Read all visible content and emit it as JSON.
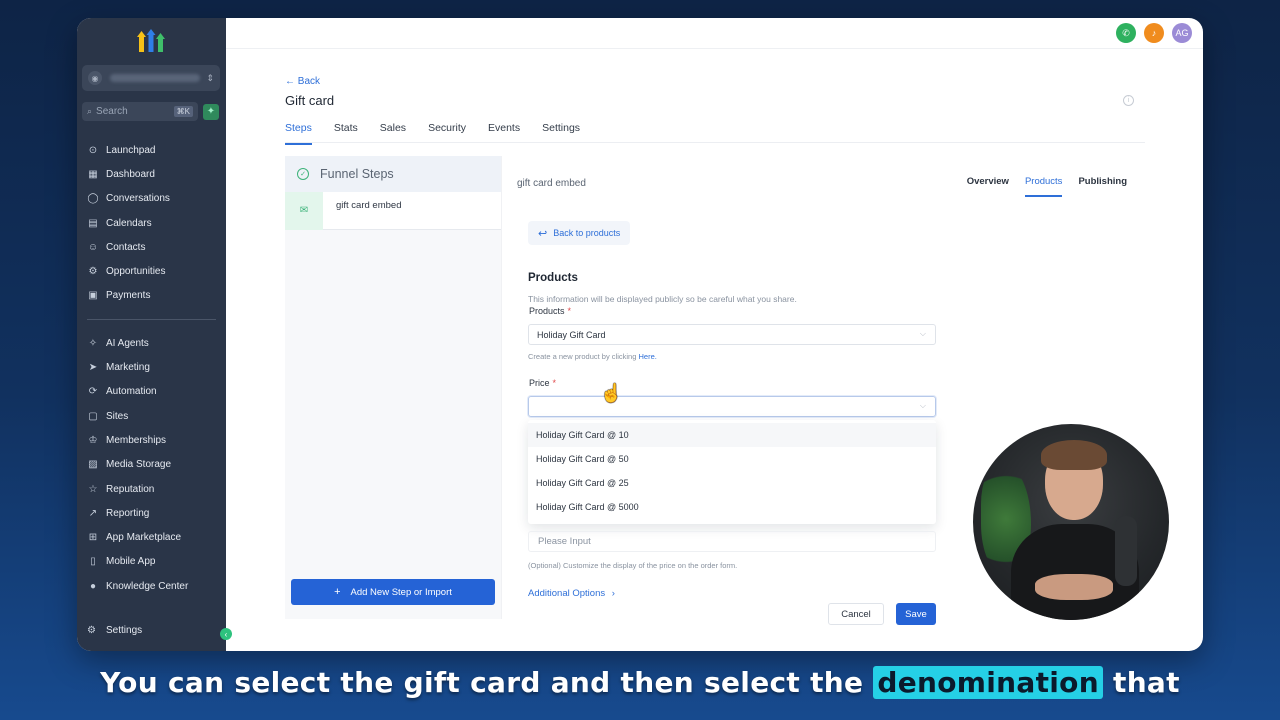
{
  "sidebar": {
    "search_placeholder": "Search",
    "search_shortcut": "⌘K",
    "nav": [
      {
        "label": "Launchpad",
        "icon": "rocket-icon"
      },
      {
        "label": "Dashboard",
        "icon": "dashboard-icon"
      },
      {
        "label": "Conversations",
        "icon": "chat-icon"
      },
      {
        "label": "Calendars",
        "icon": "calendar-icon"
      },
      {
        "label": "Contacts",
        "icon": "contacts-icon"
      },
      {
        "label": "Opportunities",
        "icon": "opportunities-icon"
      },
      {
        "label": "Payments",
        "icon": "payments-icon"
      }
    ],
    "nav2": [
      {
        "label": "AI Agents",
        "icon": "sparkle-icon"
      },
      {
        "label": "Marketing",
        "icon": "megaphone-icon"
      },
      {
        "label": "Automation",
        "icon": "automation-icon"
      },
      {
        "label": "Sites",
        "icon": "sites-icon"
      },
      {
        "label": "Memberships",
        "icon": "memberships-icon"
      },
      {
        "label": "Media Storage",
        "icon": "media-icon"
      },
      {
        "label": "Reputation",
        "icon": "star-icon"
      },
      {
        "label": "Reporting",
        "icon": "chart-icon"
      },
      {
        "label": "App Marketplace",
        "icon": "grid-icon"
      },
      {
        "label": "Mobile App",
        "icon": "mobile-icon"
      },
      {
        "label": "Knowledge Center",
        "icon": "info-icon"
      }
    ],
    "settings": "Settings"
  },
  "header": {
    "avatar_initials": "AG",
    "back": "← Back",
    "title": "Gift card",
    "tabs": [
      "Steps",
      "Stats",
      "Sales",
      "Security",
      "Events",
      "Settings"
    ],
    "active_tab": "Steps"
  },
  "funnel": {
    "heading": "Funnel Steps",
    "step_name": "gift card embed",
    "add_step": "Add New Step or Import"
  },
  "editor": {
    "name": "gift card embed",
    "tabs": [
      "Overview",
      "Products",
      "Publishing"
    ],
    "active_tab": "Products",
    "back_to_products": "Back to products",
    "section_title": "Products",
    "section_sub": "This information will be displayed publicly so be careful what you share.",
    "products_label": "Products",
    "products_value": "Holiday Gift Card",
    "create_hint": "Create a new product by clicking",
    "create_hint_link": "Here.",
    "price_label": "Price",
    "price_value": "",
    "price_options": [
      "Holiday Gift Card @ 10",
      "Holiday Gift Card @ 50",
      "Holiday Gift Card @ 25",
      "Holiday Gift Card @ 5000"
    ],
    "display_placeholder": "Please Input",
    "display_hint": "(Optional) Customize the display of the price on the order form.",
    "additional_options": "Additional Options",
    "cancel": "Cancel",
    "save": "Save"
  },
  "caption": {
    "before": "You can select the gift card and then select the",
    "highlight": "denomination",
    "after": "that"
  },
  "colors": {
    "accent": "#2563d6",
    "sidebar_bg": "#2a3548",
    "caption_highlight": "#25d0e6"
  }
}
